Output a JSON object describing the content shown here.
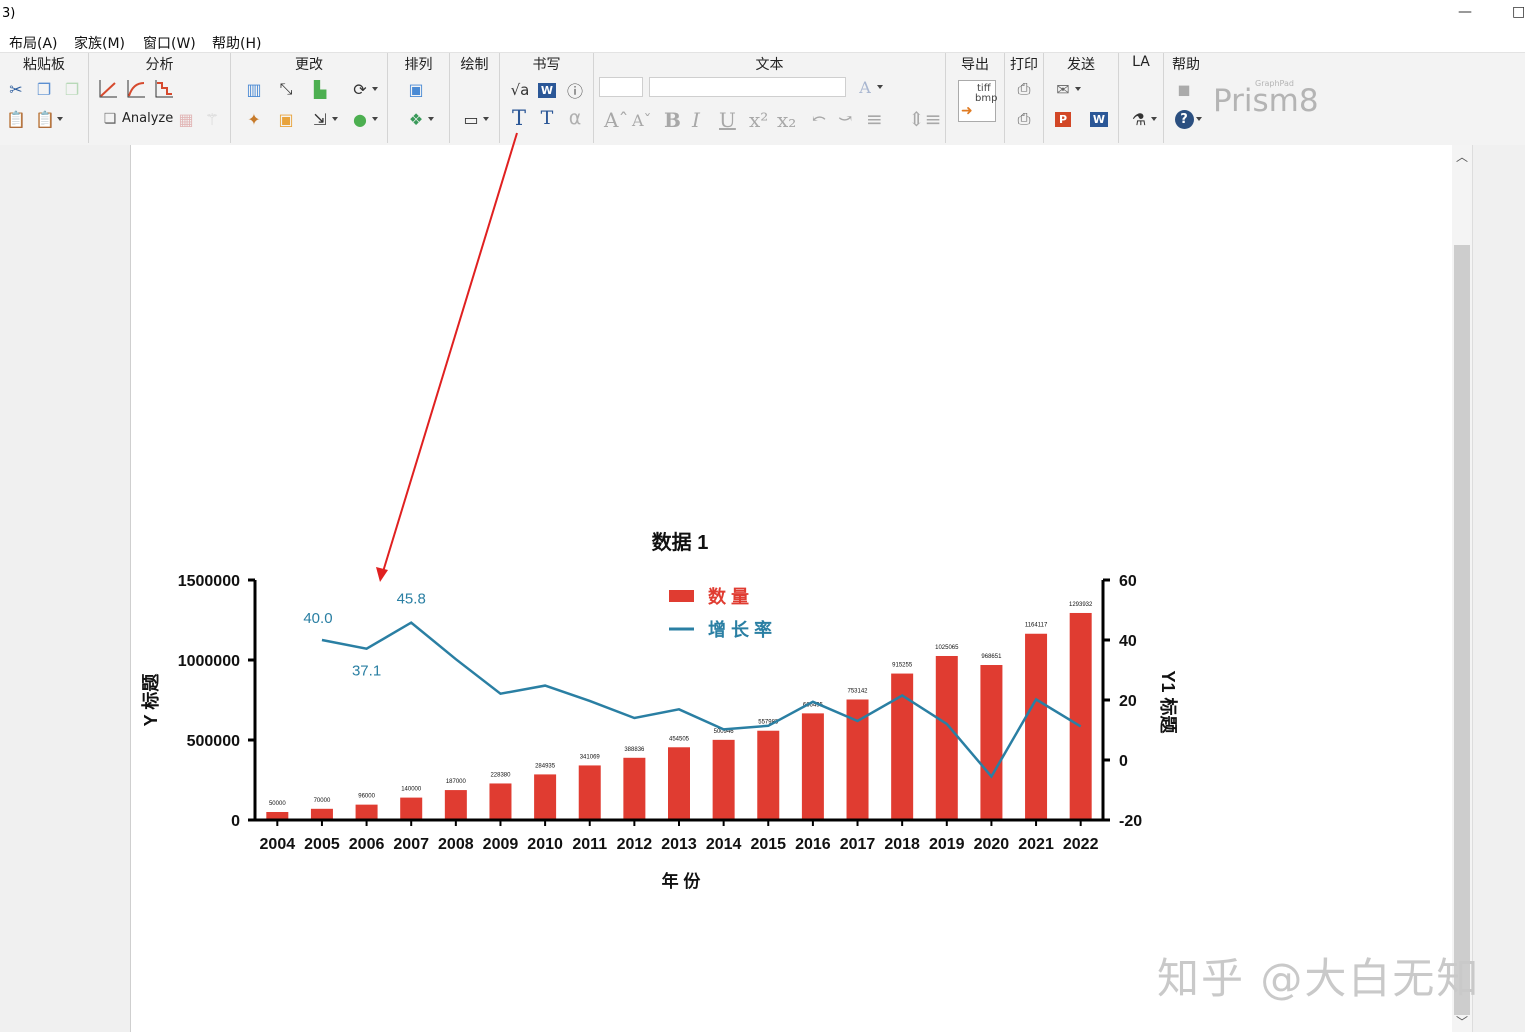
{
  "window": {
    "title": "3)",
    "minimize": "—",
    "maximize": "□"
  },
  "menu": [
    "布局(A)",
    "家族(M)",
    "窗口(W)",
    "帮助(H)"
  ],
  "ribbon": {
    "groups": [
      {
        "label": "粘贴板"
      },
      {
        "label": "分析"
      },
      {
        "label": "更改"
      },
      {
        "label": "排列"
      },
      {
        "label": "绘制"
      },
      {
        "label": "书写"
      },
      {
        "label": "文本"
      },
      {
        "label": "导出"
      },
      {
        "label": "打印"
      },
      {
        "label": "发送"
      },
      {
        "label": "LA"
      },
      {
        "label": "帮助"
      }
    ],
    "analyze_label": "Analyze",
    "tiff_label": "tiff",
    "bmp_label": "bmp",
    "brand": {
      "small": "GraphPad",
      "big": "Prism8"
    },
    "accent_color": "#e02020"
  },
  "watermark": "知乎 @大白无知",
  "chart_data": {
    "type": "bar+line",
    "title": "数据 1",
    "xlabel": "年 份",
    "ylabel": "Y 标题",
    "y2label": "Y1 标题",
    "categories": [
      "2004",
      "2005",
      "2006",
      "2007",
      "2008",
      "2009",
      "2010",
      "2011",
      "2012",
      "2013",
      "2014",
      "2015",
      "2016",
      "2017",
      "2018",
      "2019",
      "2020",
      "2021",
      "2022"
    ],
    "ylim": [
      0,
      1500000
    ],
    "yticks": [
      "0",
      "500000",
      "1000000",
      "1500000"
    ],
    "y2lim": [
      -20,
      60
    ],
    "y2ticks": [
      "-20",
      "0",
      "20",
      "40",
      "60"
    ],
    "legend_position": "top-center",
    "series": [
      {
        "name": "数 量",
        "kind": "bar",
        "color": "#e03c31",
        "values": [
          50000,
          70000,
          96000,
          140000,
          187000,
          228380,
          284935,
          341069,
          388836,
          454505,
          500946,
          557983,
          666495,
          753142,
          915255,
          1025065,
          968651,
          1164117,
          1293932
        ],
        "labels": [
          "50000",
          "70000",
          "96000",
          "140000",
          "187000",
          "228380",
          "284935",
          "341069",
          "388836",
          "454505",
          "500946",
          "557983",
          "666495",
          "753142",
          "915255",
          "1025065",
          "968651",
          "1164117",
          "1293932"
        ]
      },
      {
        "name": "增 长 率",
        "kind": "line",
        "axis": "right",
        "color": "#2a7fa3",
        "values": [
          null,
          40.0,
          37.1,
          45.8,
          33.6,
          22.1,
          24.8,
          19.7,
          14.0,
          16.9,
          10.2,
          11.4,
          19.4,
          13.0,
          21.5,
          12.0,
          -5.5,
          20.2,
          11.2
        ],
        "point_labels": {
          "2005": "40.0",
          "2006": "37.1",
          "2007": "45.8"
        }
      }
    ]
  }
}
